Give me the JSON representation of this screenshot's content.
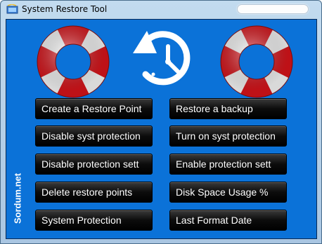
{
  "window": {
    "title": "System Restore Tool"
  },
  "brand": {
    "text": "Sordum.net"
  },
  "buttons": {
    "create_restore_point": "Create a Restore Point",
    "restore_backup": "Restore a backup",
    "disable_syst_protection": "Disable syst protection",
    "turn_on_syst_protection": "Turn on syst protection",
    "disable_protection_sett": "Disable protection sett",
    "enable_protection_sett": "Enable protection sett",
    "delete_restore_points": "Delete restore points",
    "disk_space_usage": "Disk Space Usage %",
    "system_protection": "System Protection",
    "last_format_date": "Last Format Date"
  },
  "icons": [
    "app-icon",
    "lifebuoy-icon",
    "restore-clock-icon"
  ],
  "colors": {
    "client_bg": "#0b72d8",
    "button_bg": "#000000",
    "buoy_red": "#e0141b",
    "buoy_white": "#ffffff"
  }
}
